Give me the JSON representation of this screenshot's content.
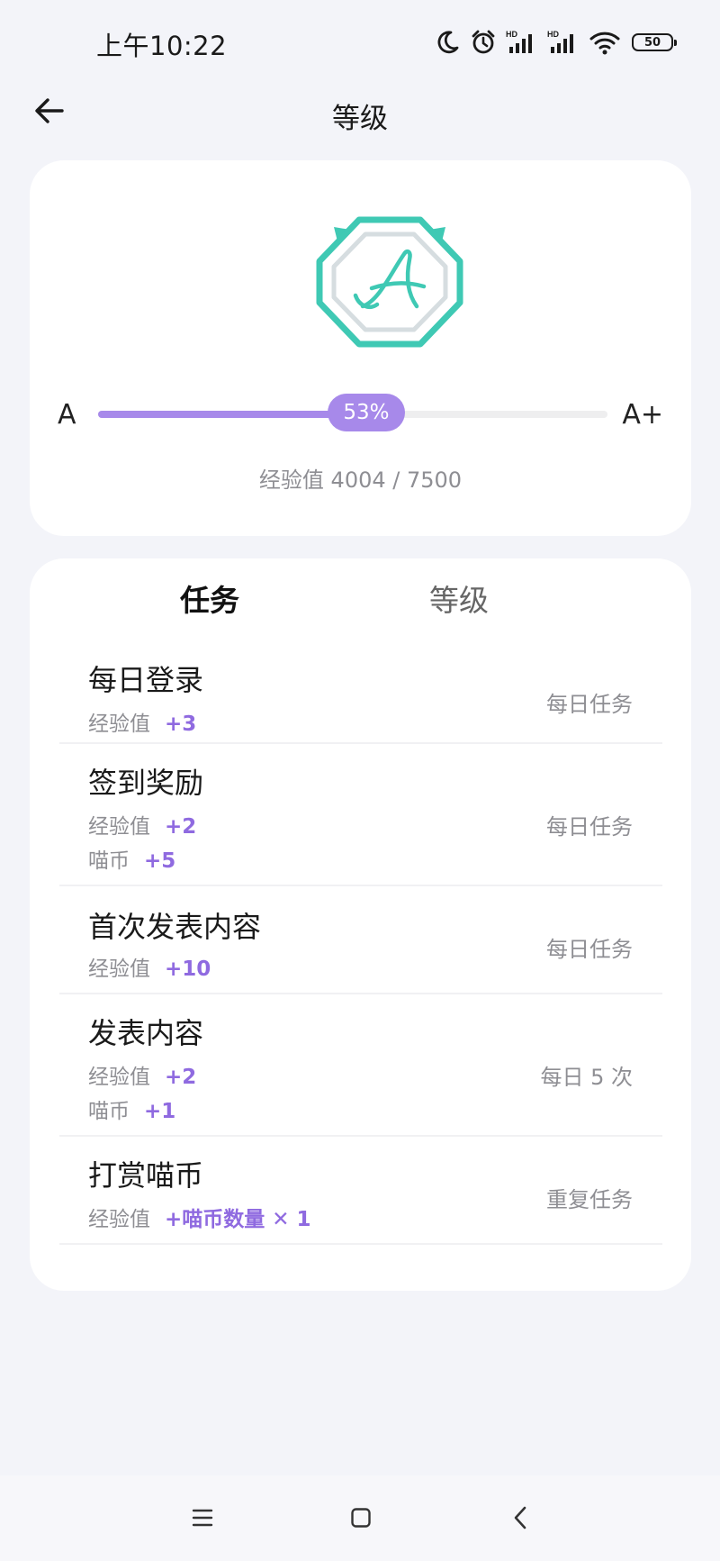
{
  "status_bar": {
    "time": "上午10:22",
    "icons": [
      "moon-icon",
      "alarm-icon",
      "hd-signal-icon",
      "hd-signal-icon",
      "wifi-icon",
      "battery-icon"
    ],
    "hd_label": "HD",
    "battery_level": "50"
  },
  "header": {
    "title": "等级",
    "back_icon": "arrow-left-icon"
  },
  "level": {
    "badge_letter": "A",
    "current": "A",
    "next": "A+",
    "progress_percent": 53,
    "progress_label": "53%",
    "exp_text": "经验值 4004 / 7500"
  },
  "tabs": [
    {
      "label": "任务",
      "active": true
    },
    {
      "label": "等级",
      "active": false
    }
  ],
  "tasks": [
    {
      "title": "每日登录",
      "frequency": "每日任务",
      "rewards": [
        {
          "label": "经验值",
          "value": "+3"
        }
      ]
    },
    {
      "title": "签到奖励",
      "frequency": "每日任务",
      "rewards": [
        {
          "label": "经验值",
          "value": "+2"
        },
        {
          "label": "喵币",
          "value": "+5"
        }
      ]
    },
    {
      "title": "首次发表内容",
      "frequency": "每日任务",
      "rewards": [
        {
          "label": "经验值",
          "value": "+10"
        }
      ]
    },
    {
      "title": "发表内容",
      "frequency": "每日 5 次",
      "rewards": [
        {
          "label": "经验值",
          "value": "+2"
        },
        {
          "label": "喵币",
          "value": "+1"
        }
      ]
    },
    {
      "title": "打赏喵币",
      "frequency": "重复任务",
      "rewards": [
        {
          "label": "经验值",
          "value": "+喵币数量 ✕ 1"
        }
      ]
    }
  ],
  "colors": {
    "accent": "#a789ea",
    "reward": "#8f6ae0",
    "badge": "#3fc9b4",
    "background": "#f3f4f9"
  },
  "bottom_nav": [
    "menu-icon",
    "home-square-icon",
    "back-chevron-icon"
  ]
}
